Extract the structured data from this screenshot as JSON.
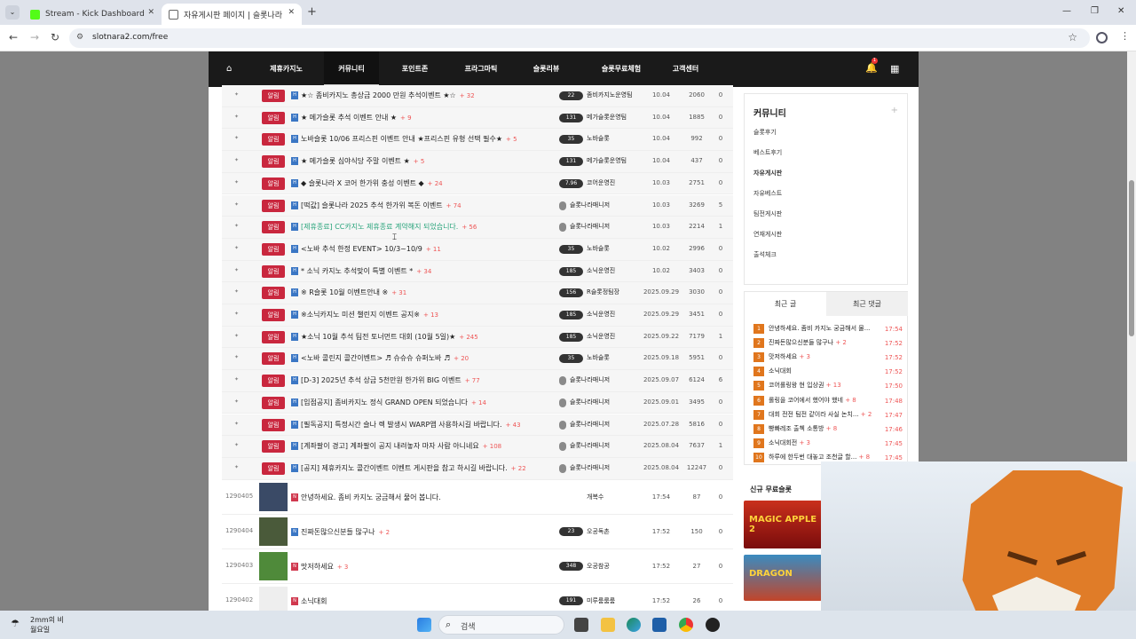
{
  "browser": {
    "tab1_title": "Stream - Kick Dashboard",
    "tab2_title": "자유게시판 페이지 | 슬롯나라",
    "url": "slotnara2.com/free"
  },
  "nav": {
    "items": [
      "제휴카지노",
      "커뮤니티",
      "포인트존",
      "프라그마틱",
      "슬롯리뷰",
      "슬롯무료체험",
      "고객센터"
    ],
    "active": "커뮤니티",
    "bell_count": "1"
  },
  "notices": [
    {
      "badge": "알림",
      "title": "★☆ 좀비카지노 총상금 2000 만원 추석이벤트 ★☆",
      "cnt": "+ 32",
      "lvl": "22",
      "author": "좀비카지노운영팀",
      "date": "10.04",
      "views": "2060",
      "votes": "0"
    },
    {
      "badge": "알림",
      "title": "★ 메가슬롯 추석 이벤트 안내 ★",
      "cnt": "+ 9",
      "lvl": "131",
      "author": "메가슬롯운영팀",
      "date": "10.04",
      "views": "1885",
      "votes": "0"
    },
    {
      "badge": "알림",
      "title": "노바슬롯 10/06 프리스핀 이벤트 안내 ★프리스핀 유형 선택 필수★",
      "cnt": "+ 5",
      "lvl": "35",
      "author": "노바슬롯",
      "date": "10.04",
      "views": "992",
      "votes": "0"
    },
    {
      "badge": "알림",
      "title": "★ 메가슬롯 심야식당 주말 이벤트 ★",
      "cnt": "+ 5",
      "lvl": "131",
      "author": "메가슬롯운영팀",
      "date": "10.04",
      "views": "437",
      "votes": "0"
    },
    {
      "badge": "알림",
      "title": "◆ 슬롯나라 X 코어 한가위 충성 이벤트 ◆",
      "cnt": "+ 24",
      "lvl": "7.96",
      "author": "코어운영진",
      "date": "10.03",
      "views": "2751",
      "votes": "0"
    },
    {
      "badge": "알림",
      "title": "[떡값] 슬롯나라 2025 추석 한가위 복돈 이벤트",
      "cnt": "+ 74",
      "lvl": "",
      "author": "슬롯나라매니저",
      "date": "10.03",
      "views": "3269",
      "votes": "5"
    },
    {
      "badge": "알림",
      "title": "[제휴종료] CC카지노 제휴종료 계약해지 되었습니다.",
      "cnt": "+ 56",
      "lvl": "",
      "author": "슬롯나라매니저",
      "date": "10.03",
      "views": "2214",
      "votes": "1",
      "green": true
    },
    {
      "badge": "알림",
      "title": "<노바 추석 한정 EVENT> 10/3~10/9",
      "cnt": "+ 11",
      "lvl": "35",
      "author": "노바슬롯",
      "date": "10.02",
      "views": "2996",
      "votes": "0"
    },
    {
      "badge": "알림",
      "title": "* 소닉 카지노 추석맞이 특별 이벤트 *",
      "cnt": "+ 34",
      "lvl": "185",
      "author": "소닉운영진",
      "date": "10.02",
      "views": "3403",
      "votes": "0"
    },
    {
      "badge": "알림",
      "title": "※ R슬롯 10월 이벤트안내 ※",
      "cnt": "+ 31",
      "lvl": "156",
      "author": "R슬롯정팀장",
      "date": "2025.09.29",
      "views": "3030",
      "votes": "0"
    },
    {
      "badge": "알림",
      "title": "※소닉카지노 미션 챌린지 이벤트 공지※",
      "cnt": "+ 13",
      "lvl": "185",
      "author": "소닉운영진",
      "date": "2025.09.29",
      "views": "3451",
      "votes": "0"
    },
    {
      "badge": "알림",
      "title": "★소닉 10월 추석 팀전 토너먼트 대회 (10월 5일)★",
      "cnt": "+ 245",
      "lvl": "185",
      "author": "소닉운영진",
      "date": "2025.09.22",
      "views": "7179",
      "votes": "1"
    },
    {
      "badge": "알림",
      "title": "<노바 콜린지 콜간이벤트> ♬ 슈슈슈 슈퍼노바 ♬",
      "cnt": "+ 20",
      "lvl": "35",
      "author": "노바슬롯",
      "date": "2025.09.18",
      "views": "5951",
      "votes": "0"
    },
    {
      "badge": "알림",
      "title": "[D-3] 2025년 추석 상금 5천만원 한가위 BIG 이벤트",
      "cnt": "+ 77",
      "lvl": "",
      "author": "슬롯나라매니저",
      "date": "2025.09.07",
      "views": "6124",
      "votes": "6"
    },
    {
      "badge": "알림",
      "title": "[입점공지] 좀비카지노 정식 GRAND OPEN 되었습니다",
      "cnt": "+ 14",
      "lvl": "",
      "author": "슬롯나라매니저",
      "date": "2025.09.01",
      "views": "3495",
      "votes": "0"
    },
    {
      "badge": "알림",
      "title": "[필독공지] 특정시간 슬나 렉 발생시 WARP앱 사용하시길 바랍니다.",
      "cnt": "+ 43",
      "lvl": "",
      "author": "슬롯나라매니저",
      "date": "2025.07.28",
      "views": "5816",
      "votes": "0"
    },
    {
      "badge": "알림",
      "title": "[계좌팔이 경고] 계좌팔이 공지 내려놓자 마자 사람 아니네요",
      "cnt": "+ 108",
      "lvl": "",
      "author": "슬롯나라매니저",
      "date": "2025.08.04",
      "views": "7637",
      "votes": "1"
    },
    {
      "badge": "알림",
      "title": "[공지] 제휴카지노 콜간이벤트 이벤트 게시판을 참고 하시길 바랍니다.",
      "cnt": "+ 22",
      "lvl": "",
      "author": "슬롯나라매니저",
      "date": "2025.08.04",
      "views": "12247",
      "votes": "0"
    }
  ],
  "posts": [
    {
      "num": "1290405",
      "title": "안녕하세요. 좀비 카지노 궁금해서 물어 봅니다.",
      "cnt": "",
      "lvl": "",
      "author": "개복수",
      "date": "17:54",
      "views": "87",
      "votes": "0"
    },
    {
      "num": "1290404",
      "title": "진짜돈많으신분들 많구나",
      "cnt": "+ 2",
      "lvl": "23",
      "author": "오공독촌",
      "date": "17:52",
      "views": "150",
      "votes": "0"
    },
    {
      "num": "1290403",
      "title": "맛저하세요",
      "cnt": "+ 3",
      "lvl": "348",
      "author": "오공참공",
      "date": "17:52",
      "views": "27",
      "votes": "0"
    },
    {
      "num": "1290402",
      "title": "소닉대회",
      "cnt": "",
      "lvl": "191",
      "author": "미루룸룸룸",
      "date": "17:52",
      "views": "26",
      "votes": "0"
    }
  ],
  "sidebar": {
    "community_title": "커뮤니티",
    "community_plus": "+",
    "community_items": [
      "슬롯후기",
      "베스트후기",
      "자유게시판",
      "자유베스트",
      "팀전게시판",
      "연재게시판",
      "출석체크"
    ],
    "active_item": "자유게시판",
    "recent_tab_a": "최근 글",
    "recent_tab_b": "최근 댓글",
    "recent": [
      {
        "n": "1",
        "t": "안녕하세요. 좀비 카지노 궁금해서 물...",
        "c": "",
        "time": "17:54"
      },
      {
        "n": "2",
        "t": "진짜돈많으신분들 많구나",
        "c": "+ 2",
        "time": "17:52"
      },
      {
        "n": "3",
        "t": "맛저하세요",
        "c": "+ 3",
        "time": "17:52"
      },
      {
        "n": "4",
        "t": "소닉대회",
        "c": "",
        "time": "17:52"
      },
      {
        "n": "5",
        "t": "코어롤링왕 현 입상권",
        "c": "+ 13",
        "time": "17:50"
      },
      {
        "n": "6",
        "t": "롤링을 코어에서 했어야 했네",
        "c": "+ 8",
        "time": "17:48"
      },
      {
        "n": "7",
        "t": "대회 전전 팀전 같이라 사실 논치...",
        "c": "+ 2",
        "time": "17:47"
      },
      {
        "n": "8",
        "t": "빵빠레조 출첵 소통방",
        "c": "+ 8",
        "time": "17:46"
      },
      {
        "n": "9",
        "t": "소닉대회전",
        "c": "+ 3",
        "time": "17:45"
      },
      {
        "n": "10",
        "t": "하루에 한두번 대놓고 조천글 할...",
        "c": "+ 8",
        "time": "17:45"
      }
    ],
    "free_label": "신규 무료슬롯",
    "game1": "MAGIC APPLE 2",
    "game2": "DRAGON"
  },
  "taskbar": {
    "weather_temp": "2mm의 비",
    "weather_desc": "월요일",
    "search_label": "검색"
  }
}
